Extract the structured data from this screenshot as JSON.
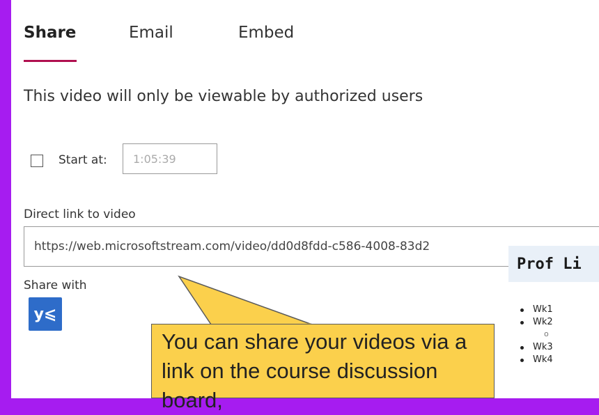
{
  "tabs": [
    {
      "label": "Share",
      "active": true
    },
    {
      "label": "Email",
      "active": false
    },
    {
      "label": "Embed",
      "active": false
    }
  ],
  "heading": "This video will only be viewable by authorized users",
  "start": {
    "label": "Start at:",
    "checked": false,
    "time_value": "1:05:39"
  },
  "direct_link": {
    "label": "Direct link to video",
    "value": "https://web.microsoftstream.com/video/dd0d8fdd-c586-4008-83d2"
  },
  "share_with": {
    "label": "Share with",
    "service_icon": "yammer-icon",
    "icon_glyph": "y⩽"
  },
  "background_doc": {
    "title": "Prof Li",
    "items": [
      "Wk1",
      "Wk2",
      "o",
      "Wk3",
      "Wk4"
    ]
  },
  "callout": {
    "text": "You can share your videos via a link on the course discussion board,"
  },
  "colors": {
    "frame": "#a61cf0",
    "accent_underline": "#b01050",
    "yammer": "#2e6cc9",
    "callout": "#fbd04c"
  }
}
